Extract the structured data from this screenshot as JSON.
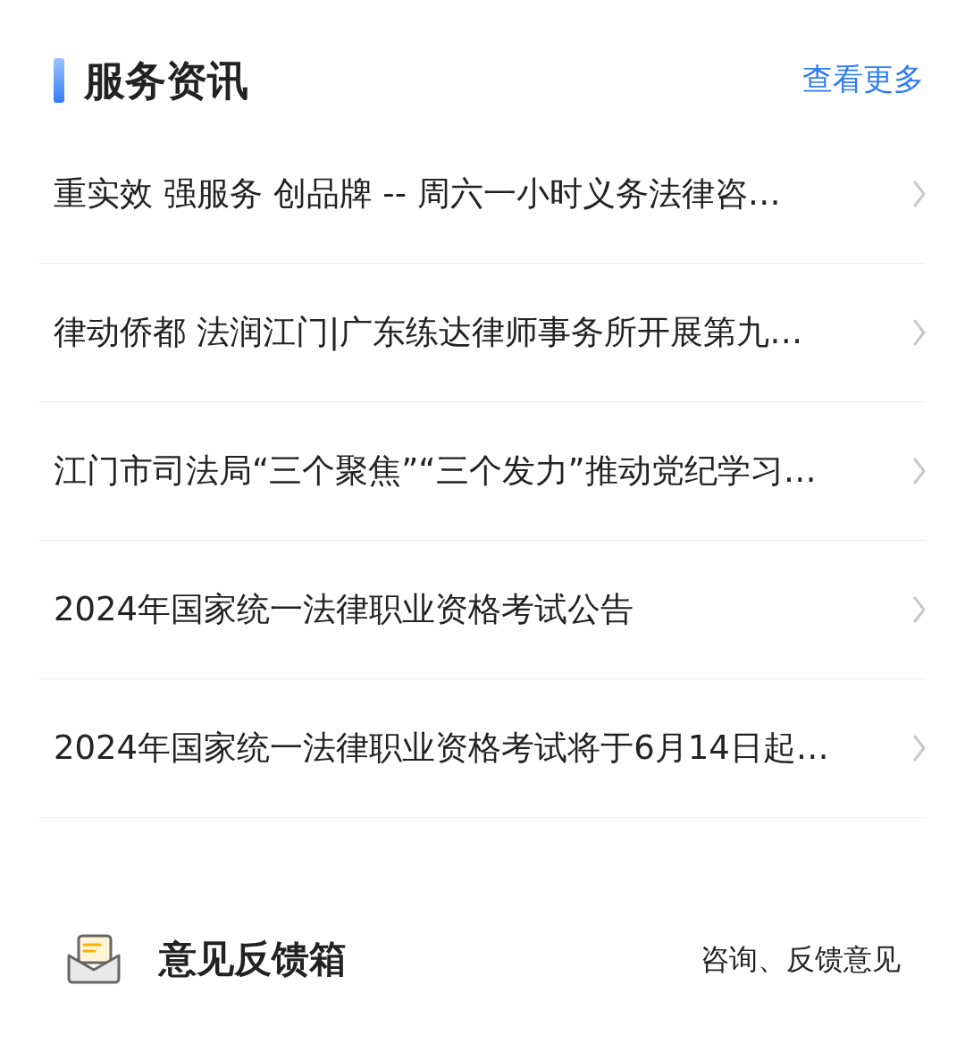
{
  "header": {
    "title": "服务资讯",
    "more_link": "查看更多"
  },
  "news": [
    {
      "title": "重实效 强服务 创品牌 -- 周六一小时义务法律咨…"
    },
    {
      "title": "律动侨都 法润江门|广东练达律师事务所开展第九…"
    },
    {
      "title": "江门市司法局“三个聚焦”“三个发力”推动党纪学习…"
    },
    {
      "title": "2024年国家统一法律职业资格考试公告"
    },
    {
      "title": "2024年国家统一法律职业资格考试将于6月14日起…"
    }
  ],
  "feedback": {
    "title": "意见反馈箱",
    "subtitle": "咨询、反馈意见"
  }
}
